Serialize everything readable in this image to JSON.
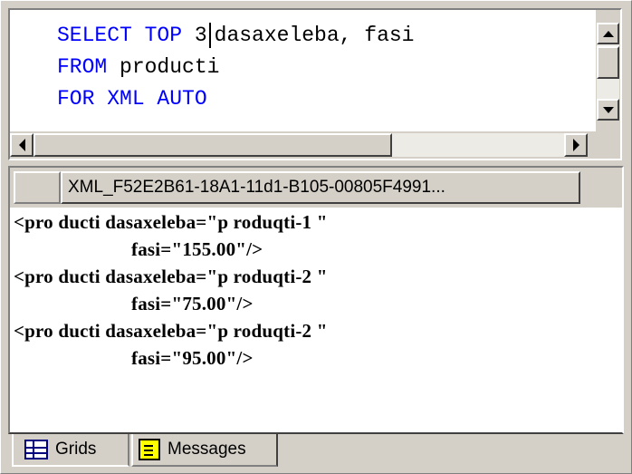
{
  "editor": {
    "lines": [
      {
        "kw": "SELECT TOP",
        "text1": " 3",
        "text2": "dasaxeleba, fasi"
      },
      {
        "kw": "FROM",
        "text": " producti"
      },
      {
        "kw": "FOR XML AUTO",
        "text": ""
      }
    ]
  },
  "results": {
    "column_header": "XML_F52E2B61-18A1-11d1-B105-00805F4991...",
    "xml_lines": [
      "<pro ducti dasaxeleba=\"p roduqti-1 \"",
      "fasi=\"155.00\"/>",
      "<pro ducti dasaxeleba=\"p roduqti-2 \"",
      "fasi=\"75.00\"/>",
      "<pro ducti dasaxeleba=\"p roduqti-2 \"",
      "fasi=\"95.00\"/>"
    ]
  },
  "tabs": {
    "grids": {
      "label": "Grids",
      "icon": "grid-icon"
    },
    "messages": {
      "label": "Messages",
      "icon": "messages-icon"
    }
  },
  "colors": {
    "keyword": "#0000ff",
    "chrome": "#d4d0c8"
  }
}
